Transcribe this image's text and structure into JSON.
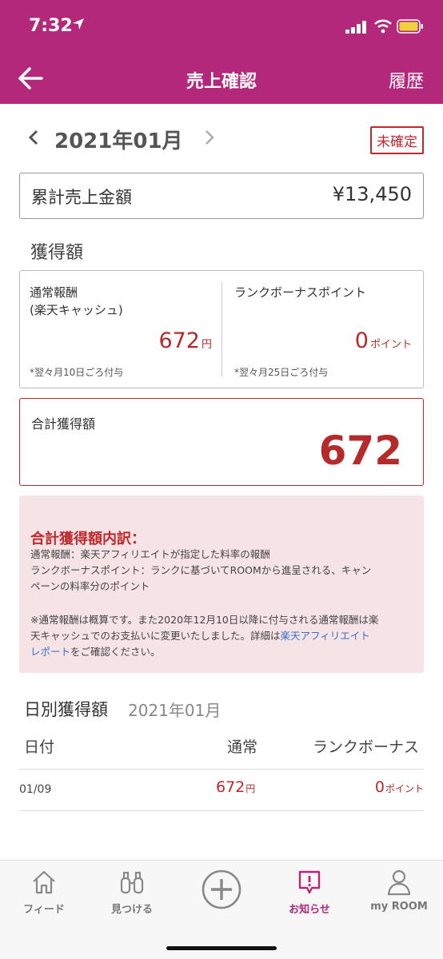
{
  "status_bar": {
    "time": "7:32"
  },
  "header": {
    "title": "売上確認",
    "history": "履歴"
  },
  "month_nav": {
    "month": "2021年01月",
    "status": "未確定"
  },
  "cumulative": {
    "label": "累計売上金額",
    "value": "¥13,450"
  },
  "earnings": {
    "section_title": "獲得額",
    "normal": {
      "label_line1": "通常報酬",
      "label_line2": "(楽天キャッシュ)",
      "amount": "672",
      "unit": "円",
      "note": "*翌々月10日ごろ付与"
    },
    "bonus": {
      "label": "ランクボーナスポイント",
      "amount": "0",
      "unit": "ポイント",
      "note": "*翌々月25日ごろ付与"
    }
  },
  "total": {
    "label": "合計獲得額",
    "value": "672"
  },
  "breakdown": {
    "title": "合計獲得額内訳：",
    "line1": "通常報酬：楽天アフィリエイトが指定した料率の報酬",
    "line2": "ランクボーナスポイント：ランクに基づいてROOMから進呈される、キャン",
    "line3": "ペーンの料率分のポイント",
    "note_line1": "※通常報酬は概算です。また2020年12月10日以降に付与される通常報酬は楽",
    "note_line2a": "天キャッシュでのお支払いに変更いたしました。詳細は",
    "note_link_a": "楽天アフィリエイト",
    "note_link_b": "レポート",
    "note_line3b": "をご確認ください。"
  },
  "daily": {
    "title": "日別獲得額",
    "month": "2021年01月",
    "columns": [
      "日付",
      "通常",
      "ランクボーナス"
    ],
    "rows": [
      {
        "date": "01/09",
        "normal": "672",
        "normal_unit": "円",
        "bonus": "0",
        "bonus_unit": "ポイント"
      }
    ]
  },
  "tabs": [
    {
      "label": "フィード",
      "icon": "home-icon"
    },
    {
      "label": "見つける",
      "icon": "binoculars-icon"
    },
    {
      "label": "",
      "icon": "plus-circle-icon"
    },
    {
      "label": "お知らせ",
      "icon": "notification-icon"
    },
    {
      "label": "my ROOM",
      "icon": "person-icon"
    }
  ],
  "colors": {
    "header": "#b3287a",
    "accent_red": "#b52b2b",
    "badge_red": "#c0282d",
    "info_bg": "#f6e3e6",
    "link": "#3c6fcb"
  }
}
